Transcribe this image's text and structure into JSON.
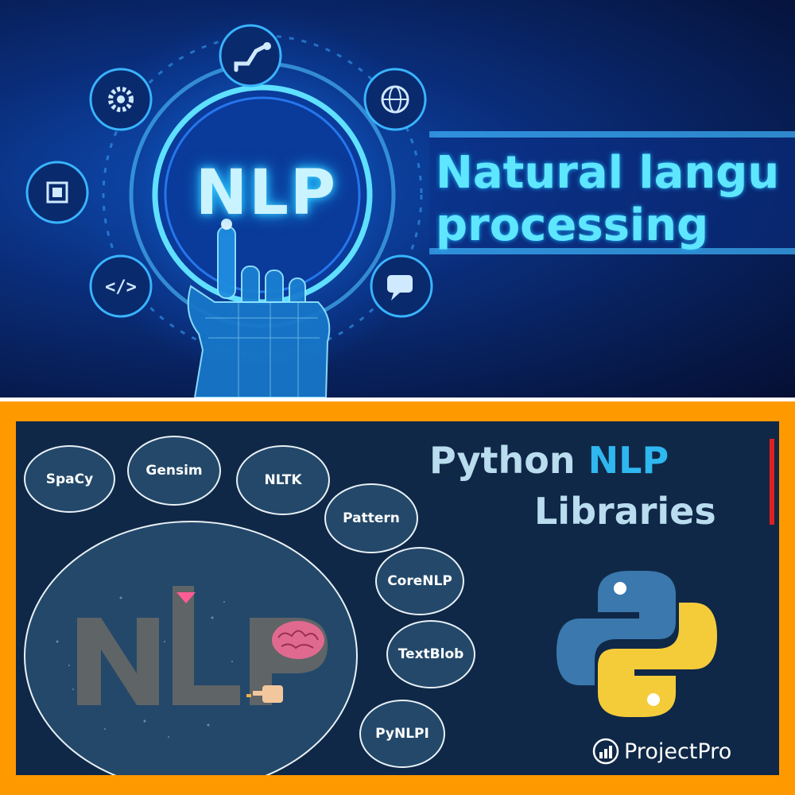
{
  "banner": {
    "badge": "NLP",
    "headline_line1": "Natural langu",
    "headline_line2": "processing",
    "icons": [
      "robot-arm-icon",
      "globe-icon",
      "chat-icon",
      "code-icon",
      "chip-icon",
      "gear-icon"
    ]
  },
  "libraries": {
    "title_word1": "Python",
    "title_word2": "NLP",
    "title_line2": "Libraries",
    "items": [
      "SpaCy",
      "Gensim",
      "NLTK",
      "Pattern",
      "CoreNLP",
      "TextBlob",
      "PyNLPI"
    ],
    "brand": "ProjectPro",
    "colors": {
      "frame": "#ff9900",
      "panel": "#102847",
      "bubble": "#23486a",
      "title_text": "#b9dcef",
      "title_accent": "#2fb7f0",
      "python_blue": "#3a78ad",
      "python_yellow": "#f4cc3a"
    }
  }
}
